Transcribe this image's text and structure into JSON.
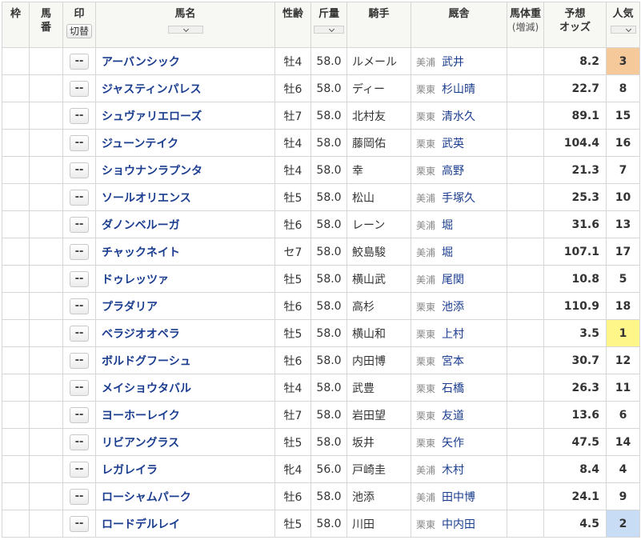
{
  "header": {
    "waku": "枠",
    "umaban": "馬番",
    "mark": "印",
    "mark_toggle": "切替",
    "name": "馬名",
    "sex_age": "性齢",
    "weight": "斤量",
    "jockey": "騎手",
    "trainer": "厩舎",
    "body_weight": "馬体重",
    "body_weight_sub": "(増減)",
    "odds_line1": "予想",
    "odds_line2": "オッズ",
    "popularity": "人気"
  },
  "colors": {
    "accent_name": "#1a3d8f",
    "odds_hot": "#d2555a",
    "pop1": "#fff689",
    "pop2": "#c8dcf5",
    "pop3": "#f6c99b"
  },
  "horses": [
    {
      "mark": "--",
      "name": "アーバンシック",
      "sex_age": "牡4",
      "weight": "58.0",
      "jockey": "ルメール",
      "region": "美浦",
      "trainer": "武井",
      "odds": "8.2",
      "popularity": "3"
    },
    {
      "mark": "--",
      "name": "ジャスティンパレス",
      "sex_age": "牡6",
      "weight": "58.0",
      "jockey": "ディー",
      "region": "栗東",
      "trainer": "杉山晴",
      "odds": "22.7",
      "popularity": "8"
    },
    {
      "mark": "--",
      "name": "シュヴァリエローズ",
      "sex_age": "牡7",
      "weight": "58.0",
      "jockey": "北村友",
      "region": "栗東",
      "trainer": "清水久",
      "odds": "89.1",
      "popularity": "15"
    },
    {
      "mark": "--",
      "name": "ジューンテイク",
      "sex_age": "牡4",
      "weight": "58.0",
      "jockey": "藤岡佑",
      "region": "栗東",
      "trainer": "武英",
      "odds": "104.4",
      "popularity": "16"
    },
    {
      "mark": "--",
      "name": "ショウナンラプンタ",
      "sex_age": "牡4",
      "weight": "58.0",
      "jockey": "幸",
      "region": "栗東",
      "trainer": "高野",
      "odds": "21.3",
      "popularity": "7"
    },
    {
      "mark": "--",
      "name": "ソールオリエンス",
      "sex_age": "牡5",
      "weight": "58.0",
      "jockey": "松山",
      "region": "美浦",
      "trainer": "手塚久",
      "odds": "25.3",
      "popularity": "10"
    },
    {
      "mark": "--",
      "name": "ダノンベルーガ",
      "sex_age": "牡6",
      "weight": "58.0",
      "jockey": "レーン",
      "region": "美浦",
      "trainer": "堀",
      "odds": "31.6",
      "popularity": "13"
    },
    {
      "mark": "--",
      "name": "チャックネイト",
      "sex_age": "セ7",
      "weight": "58.0",
      "jockey": "鮫島駿",
      "region": "美浦",
      "trainer": "堀",
      "odds": "107.1",
      "popularity": "17"
    },
    {
      "mark": "--",
      "name": "ドゥレッツァ",
      "sex_age": "牡5",
      "weight": "58.0",
      "jockey": "横山武",
      "region": "美浦",
      "trainer": "尾関",
      "odds": "10.8",
      "popularity": "5"
    },
    {
      "mark": "--",
      "name": "プラダリア",
      "sex_age": "牡6",
      "weight": "58.0",
      "jockey": "高杉",
      "region": "栗東",
      "trainer": "池添",
      "odds": "110.9",
      "popularity": "18"
    },
    {
      "mark": "--",
      "name": "ベラジオオペラ",
      "sex_age": "牡5",
      "weight": "58.0",
      "jockey": "横山和",
      "region": "栗東",
      "trainer": "上村",
      "odds": "3.5",
      "popularity": "1"
    },
    {
      "mark": "--",
      "name": "ボルドグフーシュ",
      "sex_age": "牡6",
      "weight": "58.0",
      "jockey": "内田博",
      "region": "栗東",
      "trainer": "宮本",
      "odds": "30.7",
      "popularity": "12"
    },
    {
      "mark": "--",
      "name": "メイショウタバル",
      "sex_age": "牡4",
      "weight": "58.0",
      "jockey": "武豊",
      "region": "栗東",
      "trainer": "石橋",
      "odds": "26.3",
      "popularity": "11"
    },
    {
      "mark": "--",
      "name": "ヨーホーレイク",
      "sex_age": "牡7",
      "weight": "58.0",
      "jockey": "岩田望",
      "region": "栗東",
      "trainer": "友道",
      "odds": "13.6",
      "popularity": "6"
    },
    {
      "mark": "--",
      "name": "リビアングラス",
      "sex_age": "牡5",
      "weight": "58.0",
      "jockey": "坂井",
      "region": "栗東",
      "trainer": "矢作",
      "odds": "47.5",
      "popularity": "14"
    },
    {
      "mark": "--",
      "name": "レガレイラ",
      "sex_age": "牝4",
      "weight": "56.0",
      "jockey": "戸崎圭",
      "region": "美浦",
      "trainer": "木村",
      "odds": "8.4",
      "popularity": "4"
    },
    {
      "mark": "--",
      "name": "ローシャムパーク",
      "sex_age": "牡6",
      "weight": "58.0",
      "jockey": "池添",
      "region": "美浦",
      "trainer": "田中博",
      "odds": "24.1",
      "popularity": "9"
    },
    {
      "mark": "--",
      "name": "ロードデルレイ",
      "sex_age": "牡5",
      "weight": "58.0",
      "jockey": "川田",
      "region": "栗東",
      "trainer": "中内田",
      "odds": "4.5",
      "popularity": "2"
    }
  ]
}
